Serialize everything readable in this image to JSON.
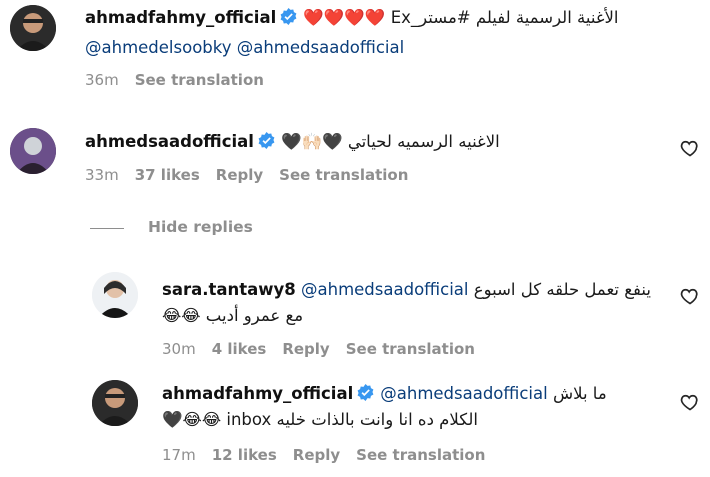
{
  "colors": {
    "verified": "#3897f0",
    "meta_text": "#8e8e8e",
    "mention": "#0a3d7a"
  },
  "comments": [
    {
      "username": "ahmadfahmy_official",
      "verified": true,
      "text_line1": "الأغنية الرسمية لفيلم #مستر_Ex ❤️❤️❤️❤️",
      "text_line2": "@ahmedelsoobky @ahmedsaadofficial",
      "time": "36m",
      "see_translation": "See translation"
    },
    {
      "username": "ahmedsaadofficial",
      "verified": true,
      "text_line1": "الاغنيه الرسميه لحياتي 🖤🙌🏻🖤",
      "time": "33m",
      "likes": "37 likes",
      "reply": "Reply",
      "see_translation": "See translation",
      "like_icon": "heart-outline-icon"
    }
  ],
  "hide_replies": "Hide replies",
  "replies": [
    {
      "username": "sara.tantawy8",
      "verified": false,
      "mention": "@ahmedsaadofficial",
      "text_line1": "ينفع تعمل حلقه كل اسبوع",
      "text_line2": "مع عمرو أديب 😂😂",
      "time": "30m",
      "likes": "4 likes",
      "reply": "Reply",
      "see_translation": "See translation",
      "like_icon": "heart-outline-icon"
    },
    {
      "username": "ahmadfahmy_official",
      "verified": true,
      "mention": "@ahmedsaadofficial",
      "text_line1": "ما بلاش",
      "text_line2": "الكلام ده انا وانت بالذات خليه inbox 😂😂🖤",
      "time": "17m",
      "likes": "12 likes",
      "reply": "Reply",
      "see_translation": "See translation",
      "like_icon": "heart-outline-icon"
    }
  ]
}
